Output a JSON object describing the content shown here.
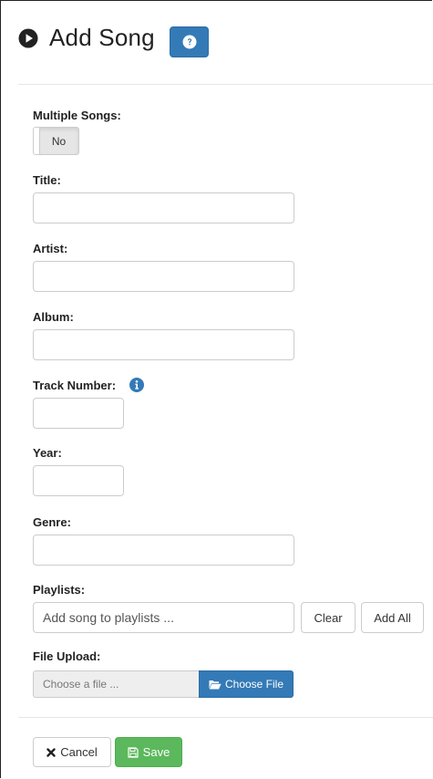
{
  "header": {
    "title": "Add Song",
    "title_icon": "play-circle-icon",
    "help_icon": "question-circle-icon"
  },
  "form": {
    "multiple_songs": {
      "label": "Multiple Songs:",
      "toggle_value": "No"
    },
    "title": {
      "label": "Title:",
      "value": ""
    },
    "artist": {
      "label": "Artist:",
      "value": ""
    },
    "album": {
      "label": "Album:",
      "value": ""
    },
    "track_number": {
      "label": "Track Number:",
      "value": "",
      "info_icon": "info-circle-icon"
    },
    "year": {
      "label": "Year:",
      "value": ""
    },
    "genre": {
      "label": "Genre:",
      "value": ""
    },
    "playlists": {
      "label": "Playlists:",
      "placeholder": "Add song to playlists ...",
      "clear_label": "Clear",
      "add_all_label": "Add All"
    },
    "file_upload": {
      "label": "File Upload:",
      "placeholder": "Choose a file ...",
      "button_label": "Choose File",
      "button_icon": "folder-open-icon"
    }
  },
  "actions": {
    "cancel_label": "Cancel",
    "cancel_icon": "times-icon",
    "save_label": "Save",
    "save_icon": "floppy-disk-icon"
  },
  "colors": {
    "primary": "#337ab7",
    "success": "#5cb85c",
    "border": "#cccccc"
  }
}
